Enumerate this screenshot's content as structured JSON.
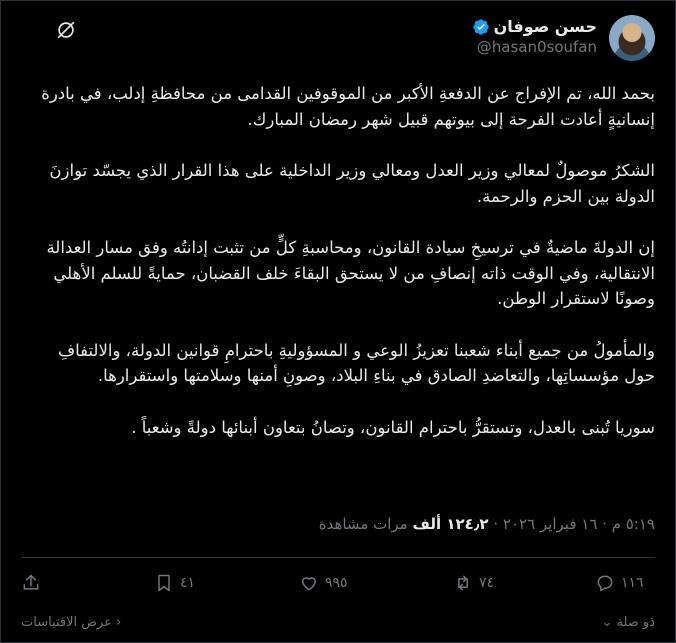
{
  "author": {
    "display_name": "حسن صوفان",
    "handle": "@hasan0soufan"
  },
  "post": {
    "paragraphs": [
      "بحمد الله، تم الإفراج عن الدفعةِ الأكبر من الموقوفين القدامى من محافظةِ إدلب، في بادرة إنسانيةٍ أعادت الفرحة إلى بيوتهم قبيل شهر رمضان المبارك.",
      "الشكرُ موصولٌ لمعالي وزير العدل ومعالي وزير الداخلية على هذا القرار الذي يجسّد توازنَ الدولة بين الحزم والرحمة.",
      "إن الدولةَ ماضيةٌ في ترسيخِ سيادة القانون، ومحاسبةِ كلٍّ من تثبت إدانتُه وفق مسار العدالة الانتقالية، وفي الوقت ذاته إنصافِ من لا يستحق البقاءَ خلف القضبان، حمايةً للسلم الأهلي وصونًا لاستقرار الوطن.",
      "والمأمولُ من جميع أبناء شعبنا تعزيزُ الوعي و المسؤوليةِ باحترامِ قوانين الدولة، والالتفافِ حول مؤسساتِها، والتعاضدِ الصادق في بناءِ البلاد، وصونِ أمنها وسلامتها واستقرارها.",
      "سوريا تُبنى بالعدل، وتستقرُّ باحترام القانون، وتصانُ بتعاون أبنائها دولةً وشعباً ."
    ]
  },
  "meta": {
    "timestamp": "٥:١٩ م · ١٦ فبراير ٢٠٢٦ · ",
    "views_count": "١٢٤٫٢ ألف",
    "views_label": " مرات مشاهدة"
  },
  "actions": {
    "replies": "١١٦",
    "reposts": "٧٤",
    "likes": "٩٩٥",
    "bookmarks": "٤١"
  },
  "footer": {
    "relevant_label": "ذو صلة",
    "quotes_label": "عرض الاقتباسات"
  },
  "colors": {
    "background": "#000000",
    "text": "#e7e9ea",
    "muted": "#71767b",
    "verified": "#1d9bf0"
  }
}
